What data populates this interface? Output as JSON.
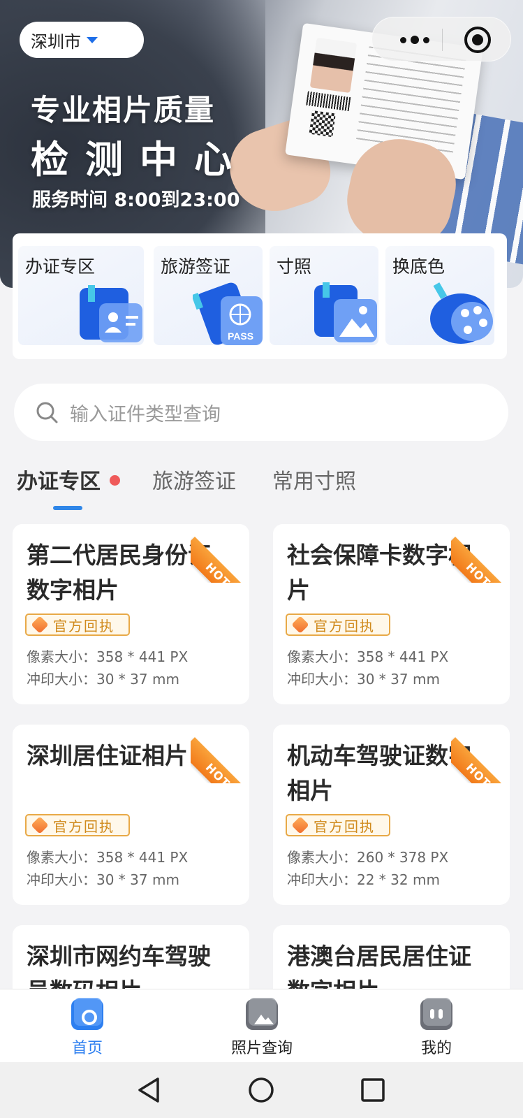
{
  "header": {
    "city": "深圳市",
    "title_line1": "专业相片质量",
    "title_line2": "检测中心",
    "hours": "服务时间 8:00到23:00"
  },
  "categories": [
    {
      "label": "办证专区",
      "icon": "id-card-icon"
    },
    {
      "label": "旅游签证",
      "icon": "passport-icon"
    },
    {
      "label": "寸照",
      "icon": "photo-icon"
    },
    {
      "label": "换底色",
      "icon": "palette-icon"
    }
  ],
  "search": {
    "placeholder": "输入证件类型查询"
  },
  "tabs": [
    {
      "label": "办证专区",
      "active": true
    },
    {
      "label": "旅游签证",
      "active": false
    },
    {
      "label": "常用寸照",
      "active": false
    }
  ],
  "badge_label": "官方回执",
  "hot_label": "HOT",
  "spec_labels": {
    "pixel": "像素大小：",
    "print": "冲印大小："
  },
  "products": [
    {
      "title": "第二代居民身份证数字相片",
      "pixel": "358 * 441 PX",
      "print": "30 * 37 mm"
    },
    {
      "title": "社会保障卡数字相片",
      "pixel": "358 * 441 PX",
      "print": "30 * 37 mm"
    },
    {
      "title": "深圳居住证相片",
      "pixel": "358 * 441 PX",
      "print": "30 * 37 mm"
    },
    {
      "title": "机动车驾驶证数字相片",
      "pixel": "260 * 378 PX",
      "print": "22 * 32 mm"
    },
    {
      "title": "深圳市网约车驾驶员数码相片",
      "pixel": "",
      "print": ""
    },
    {
      "title": "港澳台居民居住证数字相片",
      "pixel": "",
      "print": ""
    }
  ],
  "bottom_nav": [
    {
      "label": "首页",
      "icon": "home-icon",
      "active": true
    },
    {
      "label": "照片查询",
      "icon": "image-icon",
      "active": false
    },
    {
      "label": "我的",
      "icon": "profile-icon",
      "active": false
    }
  ],
  "colors": {
    "accent": "#2d7ff0",
    "hot": "#f27a1a",
    "badge": "#e8a947",
    "tab_dot": "#ef5a5a"
  }
}
